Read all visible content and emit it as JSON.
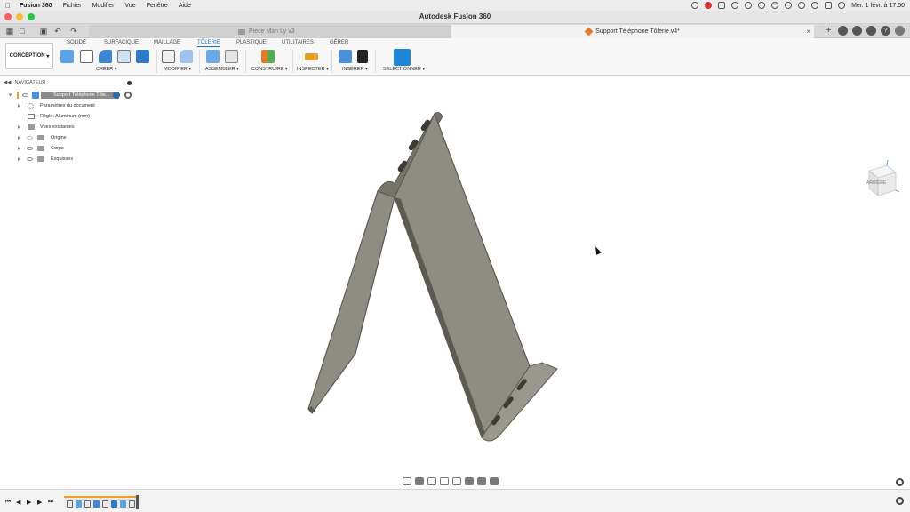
{
  "menubar": {
    "app_name": "Fusion 360",
    "items": [
      "Fichier",
      "Modifier",
      "Vue",
      "Fenêtre",
      "Aide"
    ],
    "clock": "Mer. 1 févr. à 17:50"
  },
  "window": {
    "title": "Autodesk Fusion 360"
  },
  "tabs": [
    {
      "label": "Piece Man Ly v3",
      "active": false
    },
    {
      "label": "Support Téléphone Tôlerie v4*",
      "active": true
    }
  ],
  "ribbon": {
    "workspace": "CONCEPTION",
    "tabs": [
      "SOLIDE",
      "SURFACIQUE",
      "MAILLAGE",
      "TÔLERIE",
      "PLASTIQUE",
      "UTILITAIRES",
      "GÉRER"
    ],
    "active_tab": "TÔLERIE",
    "groups": [
      "CRÉER",
      "MODIFIER",
      "ASSEMBLER",
      "CONSTRUIRE",
      "INSPECTER",
      "INSÉRER",
      "SÉLECTIONNER"
    ]
  },
  "browser": {
    "title": "NAVIGATEUR",
    "root": "Support Téléphone Tôle...",
    "nodes": [
      "Paramètres du document",
      "Règle: Aluminum (mm)",
      "Vues existantes",
      "Origine",
      "Corps",
      "Esquisses"
    ]
  },
  "viewcube": {
    "face_label": "ARRIÈRE"
  },
  "colors": {
    "accent": "#1a73c4",
    "part_face": "#8f8c84",
    "part_edge": "#5d5a54",
    "timeline_accent": "#f0a020"
  }
}
